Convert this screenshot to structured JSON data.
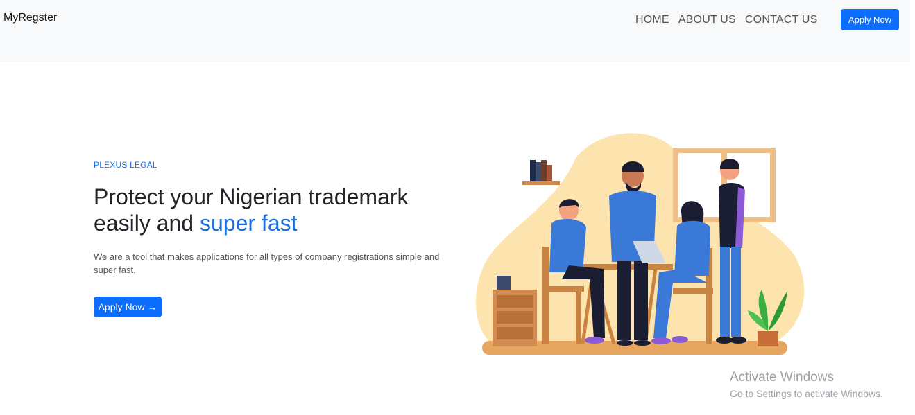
{
  "navbar": {
    "brand": "MyRegster",
    "links": [
      "HOME",
      "ABOUT US",
      "CONTACT US"
    ],
    "cta_label": "Apply Now"
  },
  "hero": {
    "eyebrow": "PLEXUS LEGAL",
    "headline_part1": "Protect your Nigerian trademark easily and",
    "headline_accent": "super fast",
    "lead": "We are a tool that makes applications for all types of company registrations simple and super fast.",
    "cta_label": "Apply Now →"
  },
  "watermark": {
    "title": "Activate Windows",
    "subtitle": "Go to Settings to activate Windows."
  },
  "colors": {
    "primary": "#0d6efd",
    "navbar_bg": "#f8f9fa",
    "blob": "#fde3ad"
  }
}
